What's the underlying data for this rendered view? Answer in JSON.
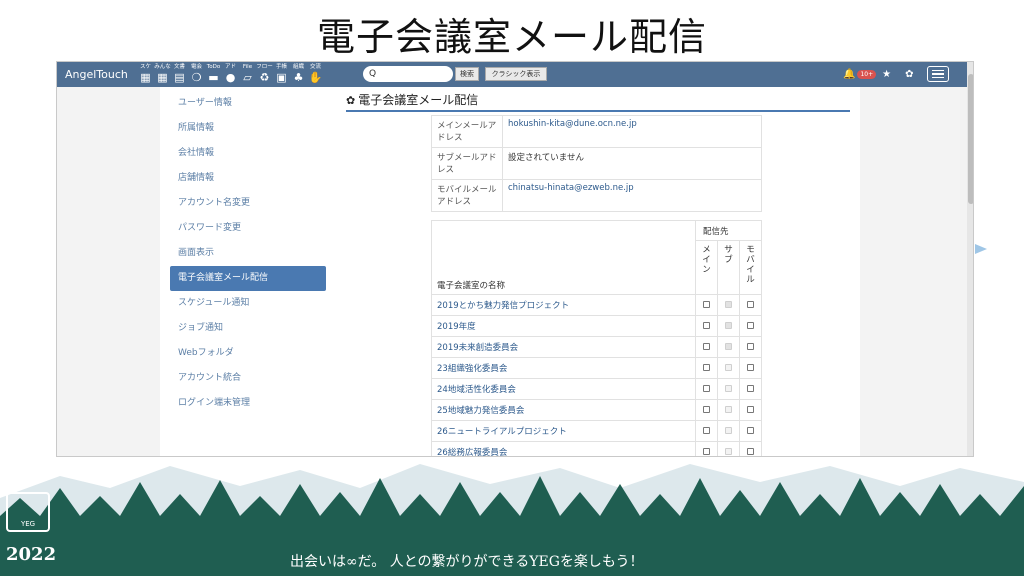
{
  "slide": {
    "title": "電子会議室メール配信",
    "footer": {
      "year": "2022",
      "logo_text": "YEG",
      "tagline": "出会いは∞だ。 人との繋がりができるYEGを楽しもう！"
    }
  },
  "navbar": {
    "brand": "AngelTouch",
    "icons": [
      {
        "label": "スケ",
        "icon": "calendar-icon",
        "glyph": "▦"
      },
      {
        "label": "みんな",
        "icon": "calendar-group-icon",
        "glyph": "▦"
      },
      {
        "label": "文書",
        "icon": "document-icon",
        "glyph": "▤"
      },
      {
        "label": "電会",
        "icon": "chat-icon",
        "glyph": "❍"
      },
      {
        "label": "ToDo",
        "icon": "todo-icon",
        "glyph": "▬"
      },
      {
        "label": "アド",
        "icon": "person-icon",
        "glyph": "●"
      },
      {
        "label": "File",
        "icon": "folder-icon",
        "glyph": "▱"
      },
      {
        "label": "フロー",
        "icon": "recycle-icon",
        "glyph": "♻"
      },
      {
        "label": "手帳",
        "icon": "notebook-icon",
        "glyph": "▣"
      },
      {
        "label": "組織",
        "icon": "org-chart-icon",
        "glyph": "♣"
      },
      {
        "label": "交流",
        "icon": "handshake-icon",
        "glyph": "✋"
      }
    ],
    "search": {
      "placeholder": "",
      "icon_glyph": "Q"
    },
    "search_button": "検索",
    "classic_button": "クラシック表示",
    "notification_badge": "10+"
  },
  "sidebar": {
    "items": [
      {
        "label": "ユーザー情報"
      },
      {
        "label": "所属情報"
      },
      {
        "label": "会社情報"
      },
      {
        "label": "店舗情報"
      },
      {
        "label": "アカウント名変更"
      },
      {
        "label": "パスワード変更"
      },
      {
        "label": "画面表示"
      },
      {
        "label": "電子会議室メール配信",
        "active": true
      },
      {
        "label": "スケジュール通知"
      },
      {
        "label": "ジョブ通知"
      },
      {
        "label": "Webフォルダ"
      },
      {
        "label": "アカウント統合"
      },
      {
        "label": "ログイン端末管理"
      }
    ]
  },
  "content": {
    "title": "電子会議室メール配信",
    "addresses": [
      {
        "key": "メインメールアドレス",
        "value": "hokushin-kita@dune.ocn.ne.jp"
      },
      {
        "key": "サブメールアドレス",
        "value": "設定されていません"
      },
      {
        "key": "モバイルメールアドレス",
        "value": "chinatsu-hinata@ezweb.ne.jp"
      }
    ],
    "list": {
      "name_header": "電子会議室の名称",
      "group_header": "配信先",
      "columns": [
        "メイン",
        "サブ",
        "モバイル"
      ],
      "rows": [
        {
          "name": "2019とかち魅力発信プロジェクト",
          "main": false,
          "sub": true,
          "mobile": false
        },
        {
          "name": "2019年度",
          "main": false,
          "sub": true,
          "mobile": false
        },
        {
          "name": "2019未来創造委員会",
          "main": false,
          "sub": true,
          "mobile": false
        },
        {
          "name": "23組織強化委員会",
          "main": false,
          "sub": false,
          "mobile": false
        },
        {
          "name": "24地域活性化委員会",
          "main": false,
          "sub": false,
          "mobile": false
        },
        {
          "name": "25地域魅力発信委員会",
          "main": false,
          "sub": false,
          "mobile": false
        },
        {
          "name": "26ニュートライアルプロジェクト",
          "main": false,
          "sub": false,
          "mobile": false
        },
        {
          "name": "26総務広報委員会",
          "main": false,
          "sub": false,
          "mobile": false
        }
      ]
    }
  },
  "colors": {
    "navbar": "#4f6f93",
    "accent": "#4a79b1",
    "link": "#2d5a8c",
    "forest": "#1f5e51"
  }
}
